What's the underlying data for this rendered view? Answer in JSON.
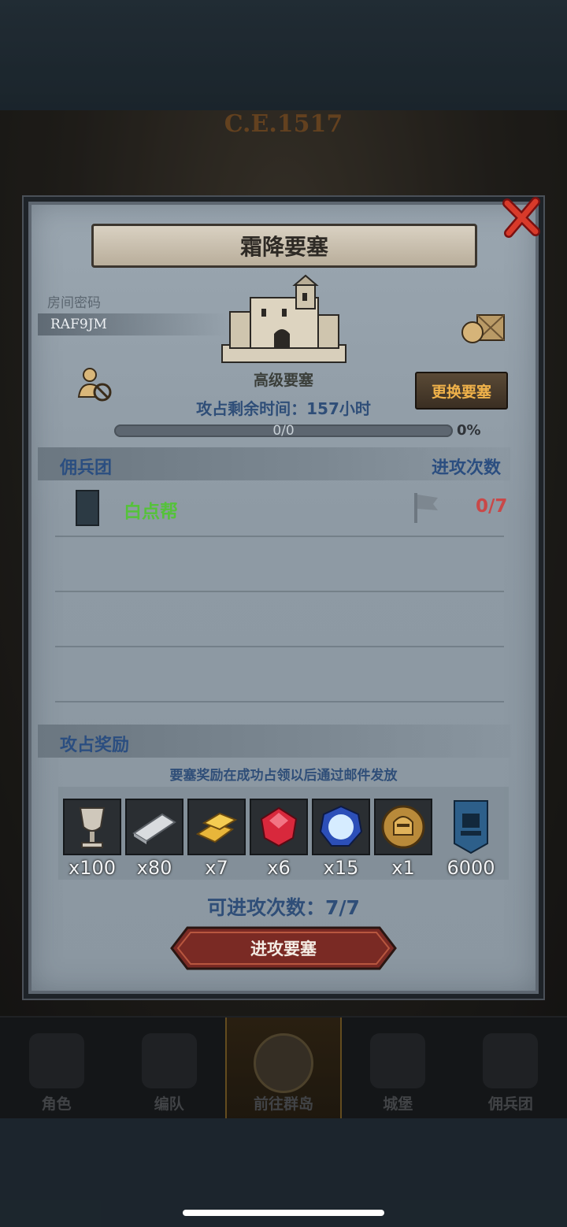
{
  "background": {
    "year_text": "C.E.1517"
  },
  "dialog": {
    "title": "霜降要塞",
    "room_code_label": "房间密码",
    "room_code": "RAF9JM",
    "fort_type": "高级要塞",
    "change_fort_label": "更换要塞",
    "time_left": "攻占剩余时间：157小时",
    "progress": {
      "text": "0/0",
      "percent_text": "0%",
      "fraction": 0
    },
    "mercenary_header": "佣兵团",
    "attack_count_header": "进攻次数",
    "guild": {
      "name": "白点帮",
      "attacks": "0/7"
    },
    "rewards_header": "攻占奖励",
    "reward_note": "要塞奖励在成功占领以后通过邮件发放",
    "rewards": [
      {
        "icon": "goblet-icon",
        "qty": "x100"
      },
      {
        "icon": "silver-bar-icon",
        "qty": "x80"
      },
      {
        "icon": "gold-bars-icon",
        "qty": "x7"
      },
      {
        "icon": "ruby-icon",
        "qty": "x6"
      },
      {
        "icon": "blue-crystal-icon",
        "qty": "x15"
      },
      {
        "icon": "golden-helmet-icon",
        "qty": "x1"
      },
      {
        "icon": "fort-banner-icon",
        "qty": "6000"
      }
    ],
    "attacks_available": "可进攻次数：7/7",
    "attack_button_label": "进攻要塞"
  },
  "bottom_nav": [
    {
      "label": "角色",
      "icon": "knight-icon"
    },
    {
      "label": "编队",
      "icon": "helmet-icon"
    },
    {
      "label": "前往群岛",
      "icon": "world-map-icon",
      "active": true
    },
    {
      "label": "城堡",
      "icon": "castle-icon"
    },
    {
      "label": "佣兵团",
      "icon": "ship-icon"
    }
  ],
  "colors": {
    "title_blue": "#2f4e78",
    "guild_green": "#55c23a",
    "count_red": "#c94848",
    "change_button_text": "#f0b24a"
  }
}
